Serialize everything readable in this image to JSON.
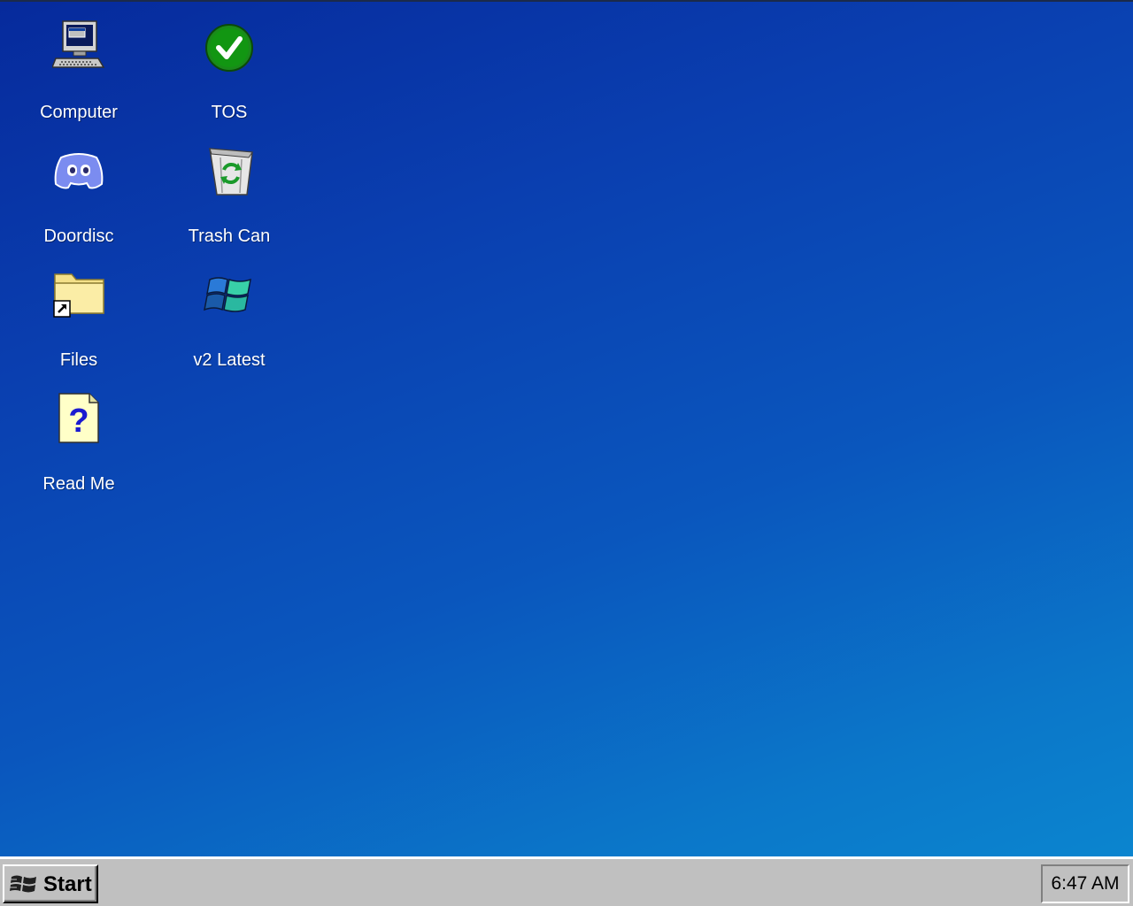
{
  "desktop": {
    "icons": [
      {
        "label": "Computer",
        "icon": "computer-icon"
      },
      {
        "label": "TOS",
        "icon": "green-checkmark-icon"
      },
      {
        "label": "Doordisc",
        "icon": "discord-controller-icon"
      },
      {
        "label": "Trash Can",
        "icon": "recycle-bin-icon"
      },
      {
        "label": "Files",
        "icon": "folder-shortcut-icon"
      },
      {
        "label": "v2 Latest",
        "icon": "windows-logo-icon"
      },
      {
        "label": "Read Me",
        "icon": "help-document-icon"
      }
    ]
  },
  "taskbar": {
    "start_label": "Start",
    "start_icon": "windows-flag-icon",
    "clock": "6:47 AM"
  },
  "colors": {
    "desktop_top": "#062a9c",
    "desktop_bottom": "#0b85cf",
    "taskbar": "#c0c0c0"
  }
}
